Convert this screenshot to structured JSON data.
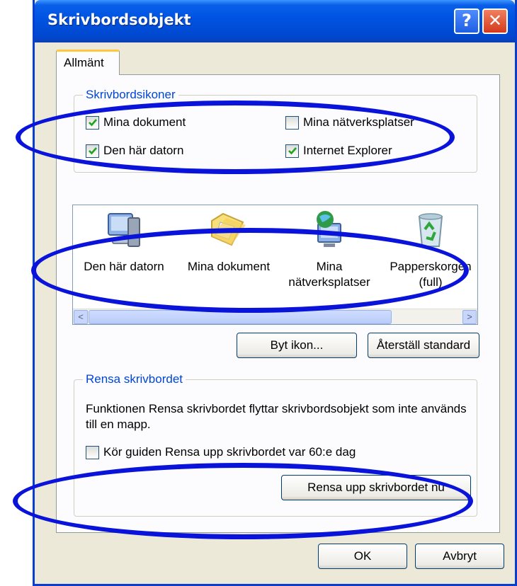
{
  "window": {
    "title": "Skrivbordsobjekt",
    "help_label": "?",
    "close_label": "✕"
  },
  "tabs": [
    {
      "label": "Allmänt",
      "selected": true
    }
  ],
  "desktop_icons_group": {
    "legend": "Skrivbordsikoner",
    "checkboxes": [
      {
        "label": "Mina dokument",
        "checked": true
      },
      {
        "label": "Mina nätverksplatser",
        "checked": false
      },
      {
        "label": "Den här datorn",
        "checked": true
      },
      {
        "label": "Internet Explorer",
        "checked": true
      }
    ]
  },
  "icon_list": {
    "items": [
      {
        "icon": "computer-icon",
        "label_line1": "Den här datorn",
        "label_line2": ""
      },
      {
        "icon": "folder-icon",
        "label_line1": "Mina dokument",
        "label_line2": ""
      },
      {
        "icon": "network-icon",
        "label_line1": "Mina",
        "label_line2": "nätverksplatser"
      },
      {
        "icon": "recycle-bin-icon",
        "label_line1": "Papperskorgen",
        "label_line2": "(full)"
      }
    ],
    "scroll_left": "<",
    "scroll_right": ">"
  },
  "buttons": {
    "change_icon": "Byt ikon...",
    "restore_default": "Återställ standard",
    "cleanup_now": "Rensa upp skrivbordet nu",
    "ok": "OK",
    "cancel": "Avbryt"
  },
  "cleanup_group": {
    "legend": "Rensa skrivbordet",
    "description": "Funktionen Rensa skrivbordet flyttar skrivbordsobjekt som inte används till en mapp.",
    "checkbox_label": "Kör guiden Rensa upp skrivbordet var 60:e dag",
    "checkbox_checked": false
  },
  "colors": {
    "titlebar": "#0054e3",
    "annotation_ellipse": "#0a13d9",
    "legend_text": "#0046d5",
    "check": "#21a121"
  }
}
